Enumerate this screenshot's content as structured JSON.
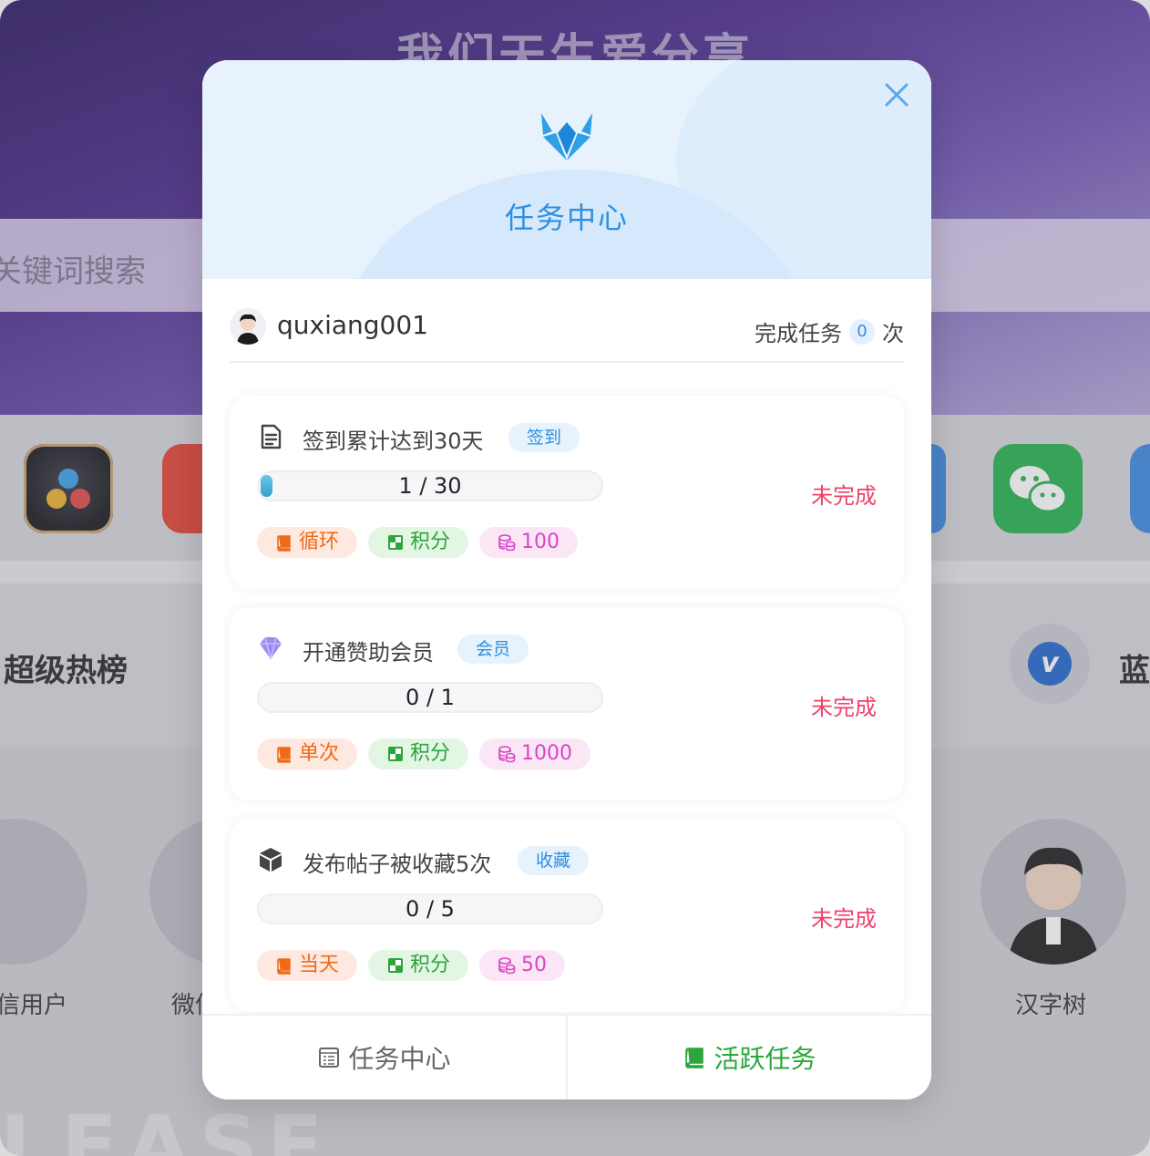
{
  "background": {
    "hero_title": "我们天生爱分享",
    "search_placeholder": "关键词搜索",
    "hot_title": "超级热榜",
    "hot_right": "蓝",
    "users": [
      "信用户",
      "微信",
      "汉字树"
    ],
    "release_text": "LEASE"
  },
  "modal": {
    "title": "任务中心",
    "close_icon": "close-icon",
    "user": {
      "name": "quxiang001",
      "done_label": "完成任务",
      "done_count": "0",
      "done_suffix": "次"
    },
    "tasks": [
      {
        "icon": "document-icon",
        "title": "签到累计达到30天",
        "tag": "签到",
        "progress_text": "1 / 30",
        "progress": 0.033,
        "status": "未完成",
        "chips": {
          "cycle": "循环",
          "type": "积分",
          "points": "100"
        }
      },
      {
        "icon": "diamond-icon",
        "title": "开通赞助会员",
        "tag": "会员",
        "progress_text": "0 / 1",
        "progress": 0,
        "status": "未完成",
        "chips": {
          "cycle": "单次",
          "type": "积分",
          "points": "1000"
        }
      },
      {
        "icon": "cube-icon",
        "title": "发布帖子被收藏5次",
        "tag": "收藏",
        "progress_text": "0 / 5",
        "progress": 0,
        "status": "未完成",
        "chips": {
          "cycle": "当天",
          "type": "积分",
          "points": "50"
        }
      }
    ],
    "footer": {
      "tab1": "任务中心",
      "tab2": "活跃任务",
      "active_tab": "活跃任务"
    }
  },
  "colors": {
    "accent_blue": "#2f8fe0",
    "status_red": "#f0416a",
    "active_green": "#2aa63a",
    "chip_orange": "#ef6a1a",
    "chip_pink": "#d845c8"
  }
}
